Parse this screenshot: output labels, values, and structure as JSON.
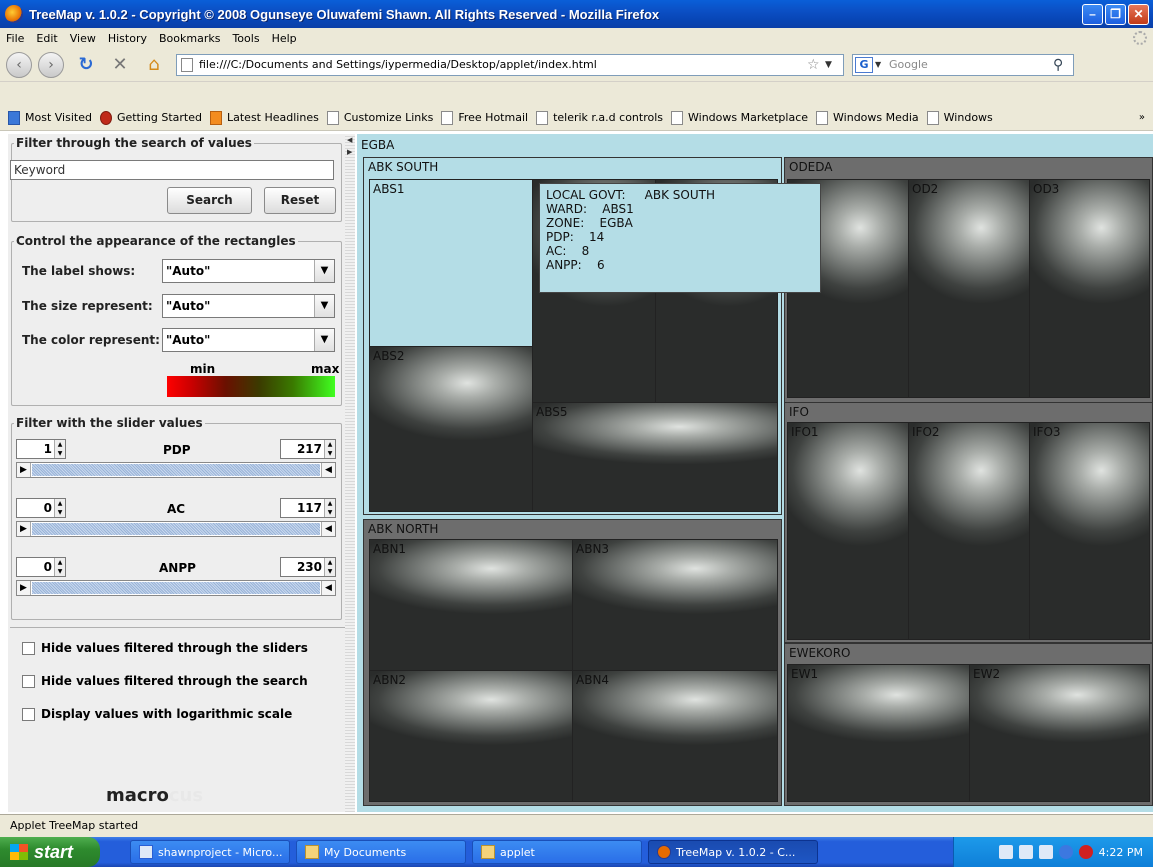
{
  "window": {
    "title": "TreeMap v. 1.0.2 - Copyright © 2008 Ogunseye Oluwafemi Shawn. All Rights Reserved - Mozilla Firefox"
  },
  "menu": [
    "File",
    "Edit",
    "View",
    "History",
    "Bookmarks",
    "Tools",
    "Help"
  ],
  "nav": {
    "url": "file:///C:/Documents and Settings/iypermedia/Desktop/applet/index.html",
    "search_placeholder": "Google"
  },
  "bookmarks": [
    "Most Visited",
    "Getting Started",
    "Latest Headlines",
    "Customize Links",
    "Free Hotmail",
    "telerik r.a.d controls",
    "Windows Marketplace",
    "Windows Media",
    "Windows"
  ],
  "panel": {
    "search_legend": "Filter through the search of values",
    "keyword_value": "Keyword",
    "search_button": "Search",
    "reset_button": "Reset",
    "appearance_legend": "Control the appearance of the rectangles",
    "label_shows": "The label shows:",
    "size_represent": "The size represent:",
    "color_represent": "The color represent:",
    "label_value": "\"Auto\"",
    "size_value": "\"Auto\"",
    "color_value": "\"Auto\"",
    "min": "min",
    "max": "max",
    "slider_legend": "Filter with the slider values",
    "sliders": [
      {
        "name": "PDP",
        "min": "1",
        "max": "217"
      },
      {
        "name": "AC",
        "min": "0",
        "max": "117"
      },
      {
        "name": "ANPP",
        "min": "0",
        "max": "230"
      }
    ],
    "checks": [
      "Hide values filtered through the sliders",
      "Hide values filtered through the search",
      "Display values with logarithmic scale"
    ],
    "logo_a": "macro",
    "logo_b": "cus"
  },
  "treemap": {
    "root": "EGBA",
    "zones": {
      "abk_south": "ABK SOUTH",
      "odeda": "ODEDA",
      "ifo": "IFO",
      "abk_north": "ABK NORTH",
      "ewekoro": "EWEKORO"
    },
    "cells": {
      "abs1": "ABS1",
      "abs2": "ABS2",
      "abs5": "ABS5",
      "od2": "OD2",
      "od3": "OD3",
      "ifo1": "IFO1",
      "ifo2": "IFO2",
      "ifo3": "IFO3",
      "abn1": "ABN1",
      "abn3": "ABN3",
      "abn2": "ABN2",
      "abn4": "ABN4",
      "ew1": "EW1",
      "ew2": "EW2"
    },
    "tooltip": [
      "LOCAL GOVT:     ABK SOUTH",
      "WARD:    ABS1",
      "ZONE:    EGBA",
      "PDP:    14",
      "AC:    8",
      "ANPP:    6"
    ]
  },
  "status": "Applet TreeMap started",
  "taskbar": {
    "start": "start",
    "tasks": [
      "shawnproject - Micro...",
      "My Documents",
      "applet",
      "TreeMap v. 1.0.2 - C..."
    ],
    "clock": "4:22 PM"
  }
}
